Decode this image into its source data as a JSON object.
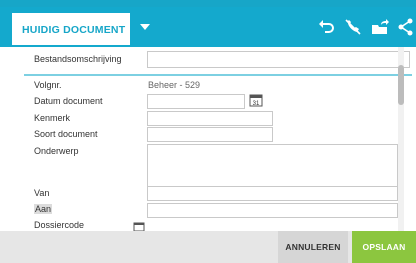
{
  "header": {
    "tab_label": "HUIDIG DOCUMENT",
    "icons": [
      "undo-icon",
      "no-phone-icon",
      "export-icon",
      "share-icon"
    ]
  },
  "form": {
    "description_label": "Bestandsomschrijving",
    "description_value": "",
    "seq_label": "Volgnr.",
    "seq_value": "Beheer - 529",
    "date_label": "Datum document",
    "date_value": "",
    "calendar_day": "31",
    "ref_label": "Kenmerk",
    "ref_value": "",
    "type_label": "Soort document",
    "type_value": "",
    "subject_label": "Onderwerp",
    "subject_value": "",
    "from_label": "Van",
    "from_value": "",
    "to_label": "Aan",
    "to_value": "",
    "dossier_label": "Dossiercode"
  },
  "footer": {
    "cancel_label": "ANNULEREN",
    "save_label": "OPSLAAN"
  },
  "colors": {
    "header": "#14a9cd",
    "save": "#8cc63f",
    "divider": "#7dd0e2"
  }
}
